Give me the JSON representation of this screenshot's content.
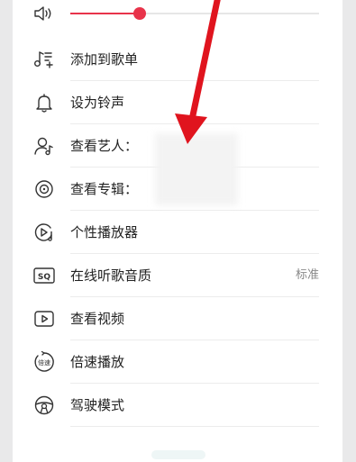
{
  "volume": {
    "level": 0.28,
    "accent_color": "#e8334a",
    "icon": "speaker-icon"
  },
  "menu": {
    "items": [
      {
        "label": "添加到歌单",
        "icon": "add-to-playlist-icon",
        "value": ""
      },
      {
        "label": "设为铃声",
        "icon": "bell-icon",
        "value": ""
      },
      {
        "label": "查看艺人：",
        "icon": "artist-icon",
        "value": ""
      },
      {
        "label": "查看专辑：",
        "icon": "album-icon",
        "value": ""
      },
      {
        "label": "个性播放器",
        "icon": "player-skin-icon",
        "value": ""
      },
      {
        "label": "在线听歌音质",
        "icon": "sq-quality-icon",
        "value": "标准"
      },
      {
        "label": "查看视频",
        "icon": "video-icon",
        "value": ""
      },
      {
        "label": "倍速播放",
        "icon": "playback-speed-icon",
        "value": ""
      },
      {
        "label": "驾驶模式",
        "icon": "steering-wheel-icon",
        "value": ""
      }
    ]
  },
  "sq_badge_text": "SQ",
  "speed_badge_text": "倍速",
  "annotation": {
    "arrow_color": "#e0141e"
  }
}
